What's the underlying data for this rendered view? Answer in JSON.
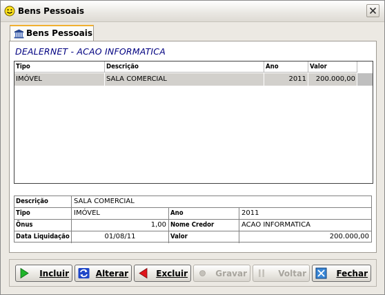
{
  "window": {
    "title": "Bens Pessoais",
    "icon": "smiley-icon"
  },
  "tab": {
    "label": "Bens Pessoais",
    "icon": "bank-icon"
  },
  "company": "DEALERNET - ACAO INFORMATICA",
  "grid": {
    "columns": [
      "Tipo",
      "Descrição",
      "Ano",
      "Valor"
    ],
    "rows": [
      {
        "tipo": "IMÓVEL",
        "descricao": "SALA COMERCIAL",
        "ano": "2011",
        "valor": "200.000,00"
      }
    ]
  },
  "details": {
    "descricao_label": "Descrição",
    "descricao": "SALA COMERCIAL",
    "tipo_label": "Tipo",
    "tipo": "IMÓVEL",
    "ano_label": "Ano",
    "ano": "2011",
    "onus_label": "Ônus",
    "onus": "1,00",
    "nome_credor_label": "Nome Credor",
    "nome_credor": "ACAO INFORMATICA",
    "data_liquidacao_label": "Data Liquidação",
    "data_liquidacao": "01/08/11",
    "valor_label": "Valor",
    "valor": "200.000,00"
  },
  "buttons": {
    "incluir": "Incluir",
    "alterar": "Alterar",
    "excluir": "Excluir",
    "gravar": "Gravar",
    "voltar": "Voltar",
    "fechar": "Fechar"
  },
  "colors": {
    "accent": "#000080",
    "tab_highlight": "#f0b030",
    "selected_row": "#d2d0cc"
  }
}
